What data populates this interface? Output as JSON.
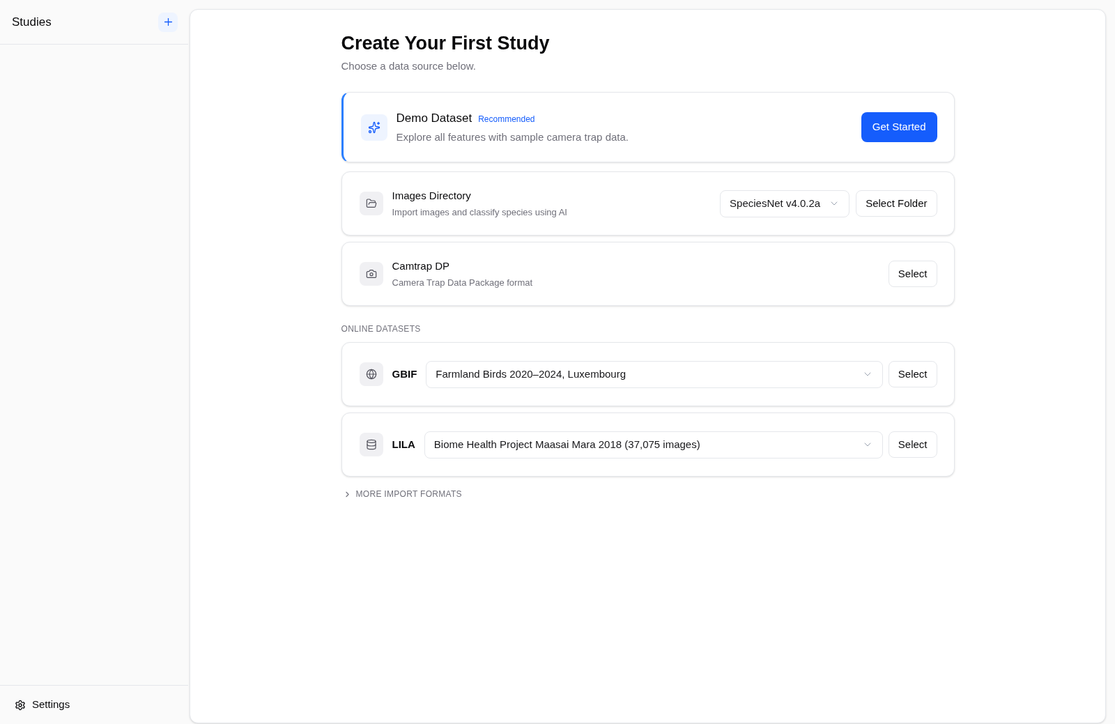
{
  "sidebar": {
    "title": "Studies",
    "footer": {
      "label": "Settings"
    }
  },
  "main": {
    "title": "Create Your First Study",
    "subtitle": "Choose a data source below.",
    "sources": [
      {
        "kind": "featured",
        "title": "Demo Dataset",
        "badge": "Recommended",
        "description": "Explore all features with sample camera trap data.",
        "button": "Get Started"
      },
      {
        "kind": "model_select",
        "title": "Images Directory",
        "description": "Import images and classify species using AI",
        "dropdown": {
          "value": "SpeciesNet v4.0.2a"
        },
        "button": "Select Folder"
      },
      {
        "kind": "basic",
        "title": "Camtrap DP",
        "description": "Camera Trap Data Package format",
        "button": "Select"
      }
    ],
    "online_datasets": {
      "heading": "ONLINE DATASETS",
      "items": [
        {
          "label": "GBIF",
          "dropdown": {
            "value": "Farmland Birds 2020–2024, Luxembourg"
          },
          "button": "Select"
        },
        {
          "label": "LILA",
          "dropdown": {
            "value": "Biome Health Project Maasai Mara 2018 (37,075 images)"
          },
          "button": "Select"
        }
      ]
    },
    "more_formats": {
      "label": "MORE IMPORT FORMATS",
      "expanded": false
    }
  }
}
